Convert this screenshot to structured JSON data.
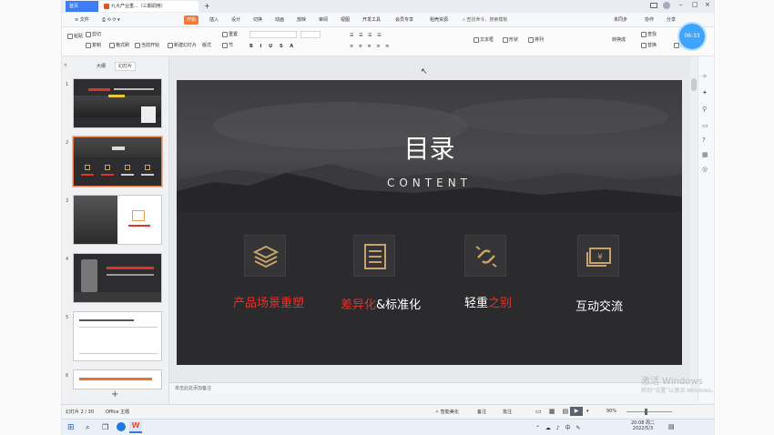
{
  "titlebar": {
    "home_tab": "首页",
    "doc_tab": "九大产业重...（三期调用）",
    "add_tab": "+"
  },
  "menubar": {
    "file": "≡ 文件",
    "items": [
      "开始",
      "插入",
      "设计",
      "切换",
      "动画",
      "放映",
      "审阅",
      "视图",
      "开发工具",
      "会员专享",
      "稻壳资源"
    ],
    "search": "查找命令、搜索模板",
    "uncollab": "未同步",
    "collab": "协作",
    "share": "分享"
  },
  "ribbon": {
    "format_painter": "格式刷",
    "paste": "粘贴",
    "cut": "剪切",
    "copy": "复制",
    "from_current": "当前开始",
    "new_slide": "新建幻灯片",
    "layout": "版式",
    "section": "节",
    "reset": "重置",
    "textbox": "文本框",
    "shape": "形状",
    "arrange": "排列",
    "smart_art": "转换成",
    "find": "查找",
    "replace": "替换",
    "select": "选择"
  },
  "panel": {
    "tab_outline": "大纲",
    "tab_slides": "幻灯片",
    "numbers": [
      "1",
      "2",
      "3",
      "4",
      "5",
      "6"
    ],
    "add": "+"
  },
  "slide": {
    "title": "目录",
    "subtitle": "CONTENT",
    "items": [
      {
        "red": "产品场景重塑",
        "white": ""
      },
      {
        "red": "差异化",
        "white": "&标准化"
      },
      {
        "white": "轻重",
        "red": "之别"
      },
      {
        "white": "互动交流",
        "red": ""
      }
    ]
  },
  "notes": "单击此处添加备注",
  "status": {
    "slide_info": "幻灯片 2 / 30",
    "theme": "Office 主题",
    "smart_beautify": "智能美化",
    "notes_btn": "备注",
    "comment_btn": "批注",
    "zoom": "90%"
  },
  "clock": {
    "time": "20:08 周二",
    "date": "2022/5/3"
  },
  "watermark": {
    "line1": "激活 Windows",
    "line2": "转到“设置”以激活 Windows。"
  },
  "timer_badge": "06:33",
  "colors": {
    "accent": "#e0332a",
    "icon_gold": "#c8a26a",
    "slide_bg": "#2b2b2d"
  }
}
